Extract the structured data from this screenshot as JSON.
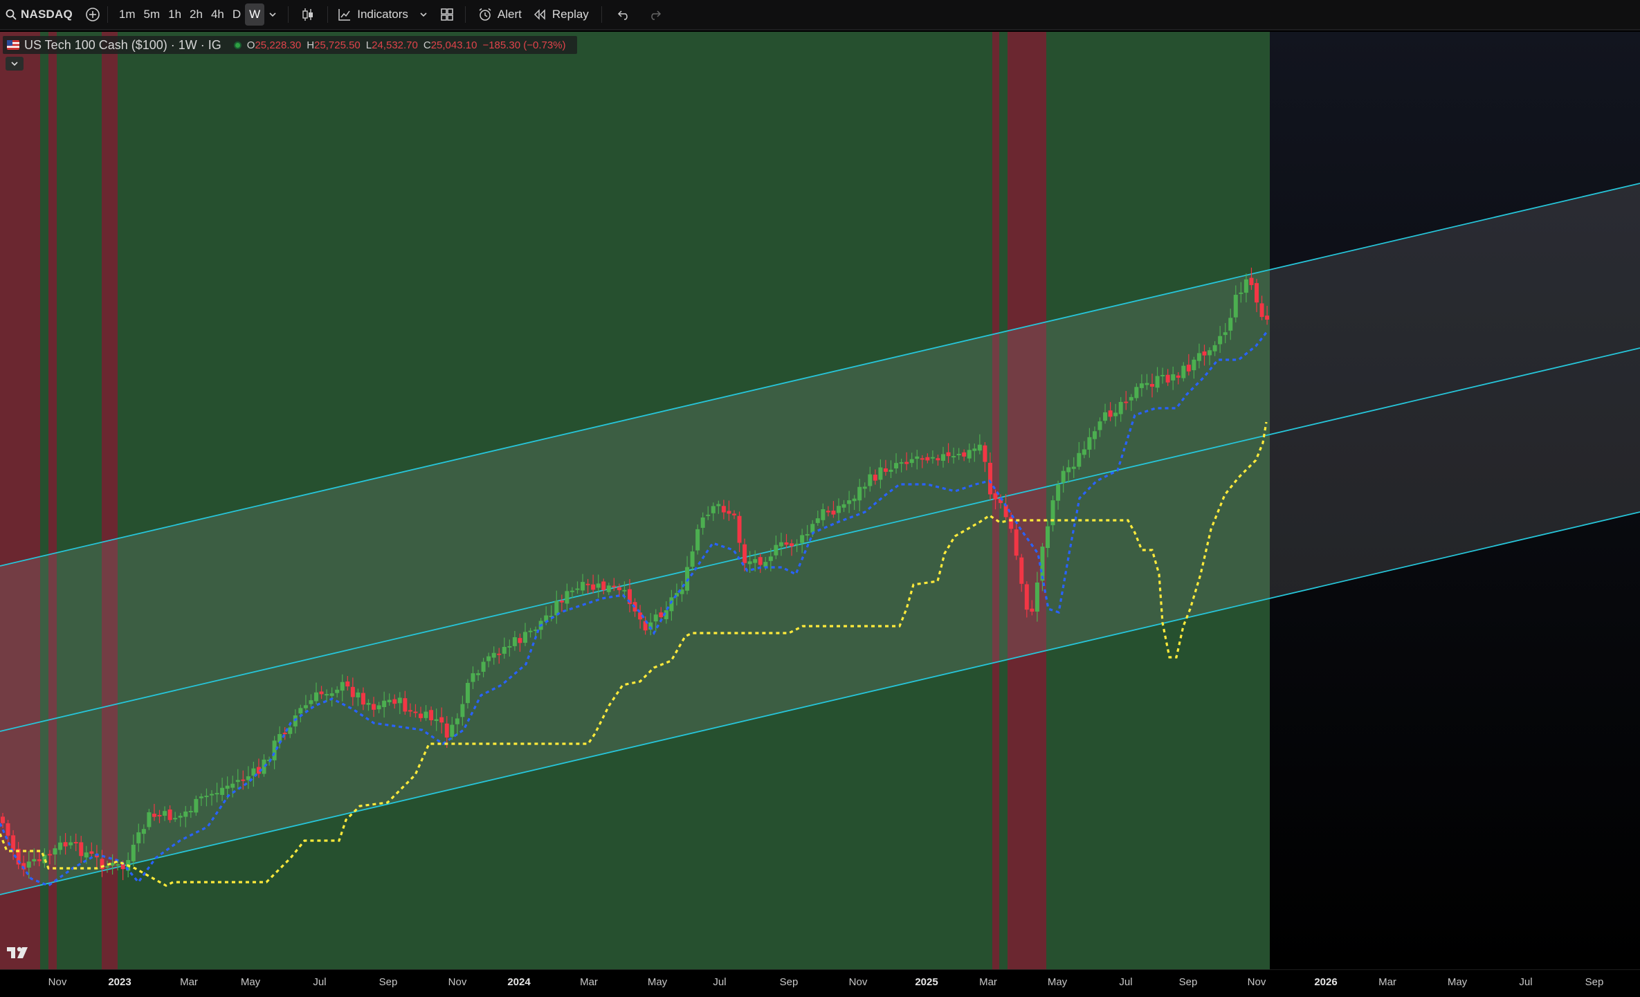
{
  "toolbar": {
    "symbol": "NASDAQ",
    "timeframes": [
      "1m",
      "5m",
      "1h",
      "2h",
      "4h",
      "D",
      "W"
    ],
    "active_timeframe": "W",
    "indicators_label": "Indicators",
    "alert_label": "Alert",
    "replay_label": "Replay",
    "icons": [
      "search-icon",
      "add-symbol-icon",
      "chevron-down-icon",
      "candles-icon",
      "indicators-icon",
      "layout-icon",
      "alert-icon",
      "replay-icon",
      "undo-icon",
      "redo-icon"
    ]
  },
  "legend": {
    "instrument": "US Tech 100 Cash ($100) · 1W · IG",
    "open_key": "O",
    "open": "25,228.30",
    "high_key": "H",
    "high": "25,725.50",
    "low_key": "L",
    "low": "24,532.70",
    "close_key": "C",
    "close": "25,043.10",
    "change": "−185.30 (−0.73%)"
  },
  "colors": {
    "up_candle": "#4caf50",
    "down_candle": "#f23645",
    "bull_zone": "#26502f",
    "bear_zone": "#6b2730",
    "channel_line": "#26c6da",
    "trail_blue": "#2962ff",
    "trail_yellow": "#ffeb3b"
  },
  "time_axis": [
    {
      "label": "Nov",
      "year": false
    },
    {
      "label": "2023",
      "year": true
    },
    {
      "label": "Mar",
      "year": false
    },
    {
      "label": "May",
      "year": false
    },
    {
      "label": "Jul",
      "year": false
    },
    {
      "label": "Sep",
      "year": false
    },
    {
      "label": "Nov",
      "year": false
    },
    {
      "label": "2024",
      "year": true
    },
    {
      "label": "Mar",
      "year": false
    },
    {
      "label": "May",
      "year": false
    },
    {
      "label": "Jul",
      "year": false
    },
    {
      "label": "Sep",
      "year": false
    },
    {
      "label": "Nov",
      "year": false
    },
    {
      "label": "2025",
      "year": true
    },
    {
      "label": "Mar",
      "year": false
    },
    {
      "label": "May",
      "year": false
    },
    {
      "label": "Jul",
      "year": false
    },
    {
      "label": "Sep",
      "year": false
    },
    {
      "label": "Nov",
      "year": false
    },
    {
      "label": "2026",
      "year": true
    },
    {
      "label": "Mar",
      "year": false
    },
    {
      "label": "May",
      "year": false
    },
    {
      "label": "Jul",
      "year": false
    },
    {
      "label": "Sep",
      "year": false
    }
  ]
}
